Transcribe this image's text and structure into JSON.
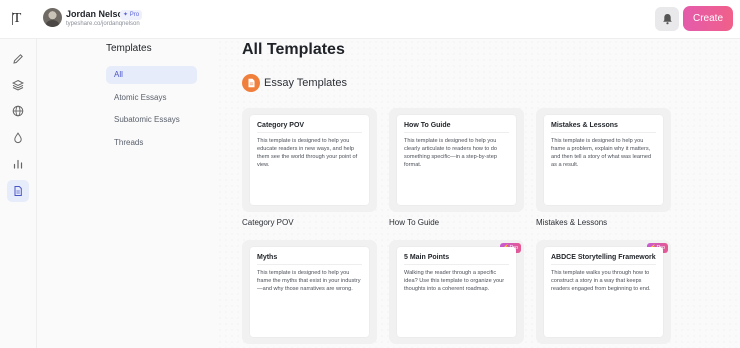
{
  "app": {
    "logo": "|T"
  },
  "user": {
    "name": "Jordan Nelson",
    "badge": "Pro",
    "handle": "typeshare.co/jordanqnelson"
  },
  "header": {
    "create_label": "Create",
    "notifications_icon": "bell-icon",
    "accent": "#e45bab"
  },
  "rail": {
    "items": [
      {
        "icon": "pencil-icon"
      },
      {
        "icon": "layers-icon"
      },
      {
        "icon": "globe-icon"
      },
      {
        "icon": "drop-icon"
      },
      {
        "icon": "bar-chart-icon"
      },
      {
        "icon": "document-icon",
        "active": true
      }
    ]
  },
  "sidebar": {
    "title": "Templates",
    "items": [
      {
        "label": "All",
        "active": true
      },
      {
        "label": "Atomic Essays"
      },
      {
        "label": "Subatomic Essays"
      },
      {
        "label": "Threads"
      }
    ]
  },
  "main": {
    "title": "All Templates",
    "section_title": "Essay Templates",
    "section_icon": "document-icon",
    "section_color": "#f07f3c",
    "cards": [
      {
        "title": "Category POV",
        "desc": "This template is designed to help you educate readers in new ways, and help them see the world through your point of view.",
        "label": "Category POV"
      },
      {
        "title": "How To Guide",
        "desc": "This template is designed to help you clearly articulate to readers how to do something specific—in a step-by-step format.",
        "label": "How To Guide"
      },
      {
        "title": "Mistakes & Lessons",
        "desc": "This template is designed to help you frame a problem, explain why it matters, and then tell a story of what was learned as a result.",
        "label": "Mistakes & Lessons"
      },
      {
        "title": "Myths",
        "desc": "This template is designed to help you frame the myths that exist in your industry—and why those narratives are wrong."
      },
      {
        "title": "5 Main Points",
        "desc": "Walking the reader through a specific idea? Use this template to organize your thoughts into a coherent roadmap.",
        "pro": "Pro"
      },
      {
        "title": "ABDCE Storytelling Framework",
        "desc": "This template walks you through how to construct a story in a way that keeps readers engaged from beginning to end.",
        "pro": "Pro"
      }
    ]
  }
}
